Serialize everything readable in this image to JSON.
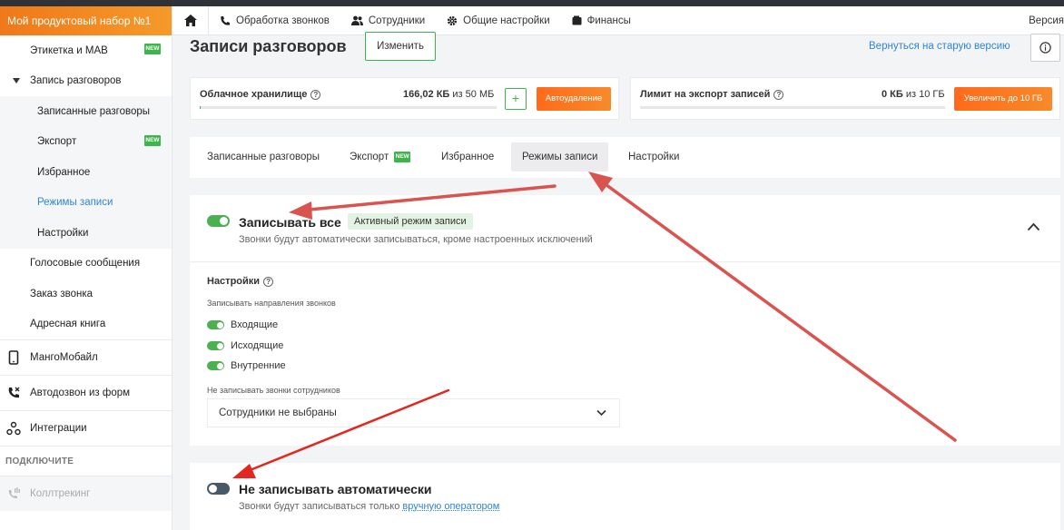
{
  "app": {
    "brand": "Мой продуктовый набор №1"
  },
  "topnav": {
    "items": [
      {
        "label": "Обработка звонков",
        "icon": "phone-icon"
      },
      {
        "label": "Сотрудники",
        "icon": "users-icon"
      },
      {
        "label": "Общие настройки",
        "icon": "gear-icon"
      },
      {
        "label": "Финансы",
        "icon": "wallet-icon"
      }
    ],
    "version": "Версия"
  },
  "sidebar": {
    "items": [
      {
        "label": "Этикетка и МАВ",
        "badge": "NEW"
      },
      {
        "label": "Запись разговоров"
      },
      {
        "label": "Записанные разговоры"
      },
      {
        "label": "Экспорт",
        "badge": "NEW"
      },
      {
        "label": "Избранное"
      },
      {
        "label": "Режимы записи"
      },
      {
        "label": "Настройки"
      },
      {
        "label": "Голосовые сообщения"
      },
      {
        "label": "Заказ звонка"
      },
      {
        "label": "Адресная книга"
      },
      {
        "label": "МангоМобайл",
        "icon": "mobile-icon"
      },
      {
        "label": "Автодозвон из форм",
        "icon": "autodial-icon"
      },
      {
        "label": "Интеграции",
        "icon": "integrations-icon"
      },
      {
        "label": "Коллтрекинг",
        "icon": "calltracking-icon"
      }
    ],
    "connect_heading": "ПОДКЛЮЧИТЕ"
  },
  "header": {
    "title": "Записи разговоров",
    "edit_label": "Изменить",
    "old_version_link": "Вернуться на старую версию"
  },
  "storage": {
    "cloud": {
      "label": "Облачное хранилище",
      "used": "166,02 КБ",
      "of": "из",
      "total": "50 МБ",
      "used_fraction": 0.003,
      "autodelete_label": "Автоудаление"
    },
    "export": {
      "label": "Лимит на экспорт записей",
      "used": "0 КБ",
      "of": "из",
      "total": "10 ГБ",
      "used_fraction": 0.0,
      "increase_label": "Увеличить до 10 ГБ"
    }
  },
  "tabs": [
    {
      "label": "Записанные разговоры"
    },
    {
      "label": "Экспорт",
      "badge": "NEW"
    },
    {
      "label": "Избранное"
    },
    {
      "label": "Режимы записи",
      "active": true
    },
    {
      "label": "Настройки"
    }
  ],
  "mode_record_all": {
    "title": "Записывать все",
    "badge": "Активный режим записи",
    "description": "Звонки будут автоматически записываться, кроме настроенных исключений",
    "enabled": true,
    "settings_title": "Настройки",
    "directions_label": "Записывать направления звонков",
    "directions": [
      {
        "label": "Входящие",
        "enabled": true
      },
      {
        "label": "Исходящие",
        "enabled": true
      },
      {
        "label": "Внутренние",
        "enabled": true
      }
    ],
    "exclude_label": "Не записывать звонки сотрудников",
    "exclude_select_value": "Сотрудники не выбраны"
  },
  "mode_manual": {
    "title": "Не записывать автоматически",
    "description_prefix": "Звонки будут записываться только",
    "description_link": "вручную оператором",
    "enabled": false
  },
  "colors": {
    "brand_orange": "#f07818",
    "accent_green": "#4caf50",
    "link_blue": "#2f86d6",
    "annotation_red": "#d9534f"
  }
}
